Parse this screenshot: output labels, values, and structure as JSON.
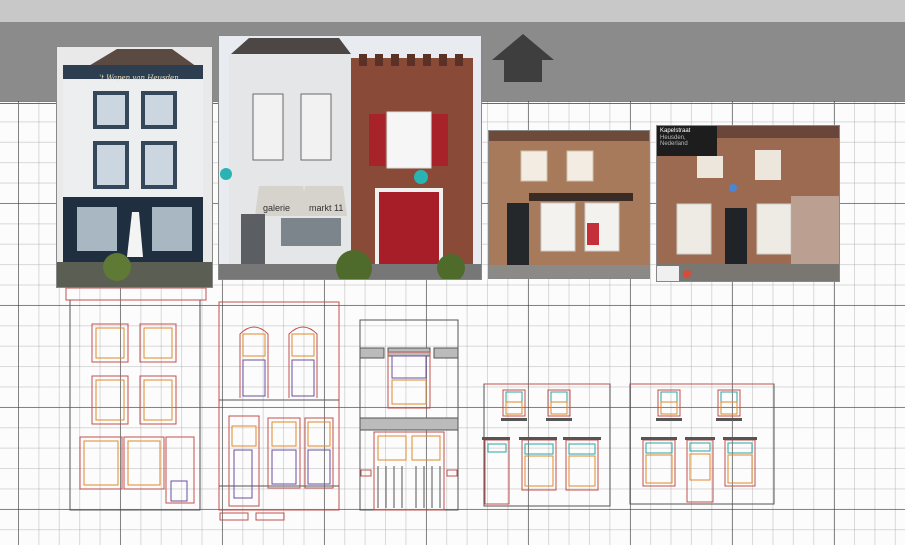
{
  "photos": {
    "photo1_sign": "'t Wapen van Heusden",
    "photo2_awning": [
      "galerie",
      "markt 11"
    ],
    "photo4_overlay_title": "Kapelstraat",
    "photo4_overlay_sub": "Heusden, Nederland"
  },
  "icons": {
    "home": "up-arrow-home-icon",
    "pin": "location-pin-icon"
  },
  "colors": {
    "toolbar": "#8b8b8b",
    "topbar": "#c8c8c8",
    "grid_major": "#3c3c3c",
    "grid_minor": "#969696",
    "drawing_red": "#c0504d",
    "drawing_orange": "#e08a2a",
    "drawing_purple": "#6a4ea0",
    "drawing_teal": "#2aa6a6",
    "drawing_gray": "#555555"
  }
}
